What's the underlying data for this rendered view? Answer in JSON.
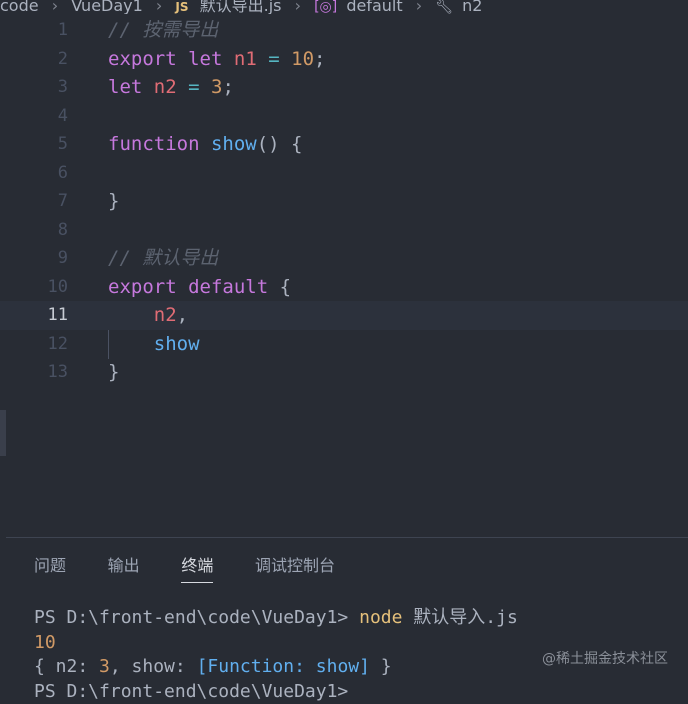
{
  "breadcrumb": {
    "items": [
      "code",
      "VueDay1",
      "默认导出.js",
      "default",
      "n2"
    ],
    "js_badge": "JS"
  },
  "editor": {
    "lines": [
      {
        "n": "1",
        "active": false,
        "tokens": [
          {
            "t": "// 按需导出",
            "c": "cm"
          }
        ]
      },
      {
        "n": "2",
        "active": false,
        "tokens": [
          {
            "t": "export",
            "c": "kw"
          },
          {
            "t": " "
          },
          {
            "t": "let",
            "c": "kw"
          },
          {
            "t": " "
          },
          {
            "t": "n1",
            "c": "var"
          },
          {
            "t": " "
          },
          {
            "t": "=",
            "c": "op"
          },
          {
            "t": " "
          },
          {
            "t": "10",
            "c": "num"
          },
          {
            "t": ";",
            "c": "punct"
          }
        ]
      },
      {
        "n": "3",
        "active": false,
        "tokens": [
          {
            "t": "let",
            "c": "kw"
          },
          {
            "t": " "
          },
          {
            "t": "n2",
            "c": "var"
          },
          {
            "t": " "
          },
          {
            "t": "=",
            "c": "op"
          },
          {
            "t": " "
          },
          {
            "t": "3",
            "c": "num"
          },
          {
            "t": ";",
            "c": "punct"
          }
        ]
      },
      {
        "n": "4",
        "active": false,
        "tokens": []
      },
      {
        "n": "5",
        "active": false,
        "tokens": [
          {
            "t": "function",
            "c": "kw"
          },
          {
            "t": " "
          },
          {
            "t": "show",
            "c": "fn"
          },
          {
            "t": "() {",
            "c": "punct"
          }
        ]
      },
      {
        "n": "6",
        "active": false,
        "tokens": []
      },
      {
        "n": "7",
        "active": false,
        "tokens": [
          {
            "t": "}",
            "c": "punct"
          }
        ]
      },
      {
        "n": "8",
        "active": false,
        "tokens": []
      },
      {
        "n": "9",
        "active": false,
        "tokens": [
          {
            "t": "// 默认导出",
            "c": "cm"
          }
        ]
      },
      {
        "n": "10",
        "active": false,
        "tokens": [
          {
            "t": "export",
            "c": "kw"
          },
          {
            "t": " "
          },
          {
            "t": "default",
            "c": "kw"
          },
          {
            "t": " {",
            "c": "punct"
          }
        ]
      },
      {
        "n": "11",
        "active": true,
        "tokens": [
          {
            "t": "    "
          },
          {
            "t": "n2",
            "c": "var"
          },
          {
            "t": ",",
            "c": "punct"
          }
        ]
      },
      {
        "n": "12",
        "active": false,
        "tokens": [
          {
            "t": "    "
          },
          {
            "t": "show",
            "c": "fn"
          }
        ]
      },
      {
        "n": "13",
        "active": false,
        "tokens": [
          {
            "t": "}",
            "c": "punct"
          }
        ]
      }
    ]
  },
  "panel": {
    "tabs": [
      {
        "label": "问题",
        "active": false
      },
      {
        "label": "输出",
        "active": false
      },
      {
        "label": "终端",
        "active": true
      },
      {
        "label": "调试控制台",
        "active": false
      }
    ]
  },
  "terminal": {
    "prompt": "PS D:\\front-end\\code\\VueDay1> ",
    "command": "node",
    "args": " 默认导入.js",
    "out1": "10",
    "out2_a": "{ n2: ",
    "out2_num": "3",
    "out2_b": ", show: ",
    "out2_fn": "[Function: show]",
    "out2_c": " }",
    "next_prompt": "PS D:\\front-end\\code\\VueDay1> "
  },
  "watermark": "@稀土掘金技术社区",
  "colors": {
    "background": "#282c34",
    "keyword": "#c678dd",
    "variable": "#e06c75",
    "number": "#d19a66",
    "function": "#61afef",
    "comment": "#5c6370",
    "command": "#e5c07b"
  }
}
